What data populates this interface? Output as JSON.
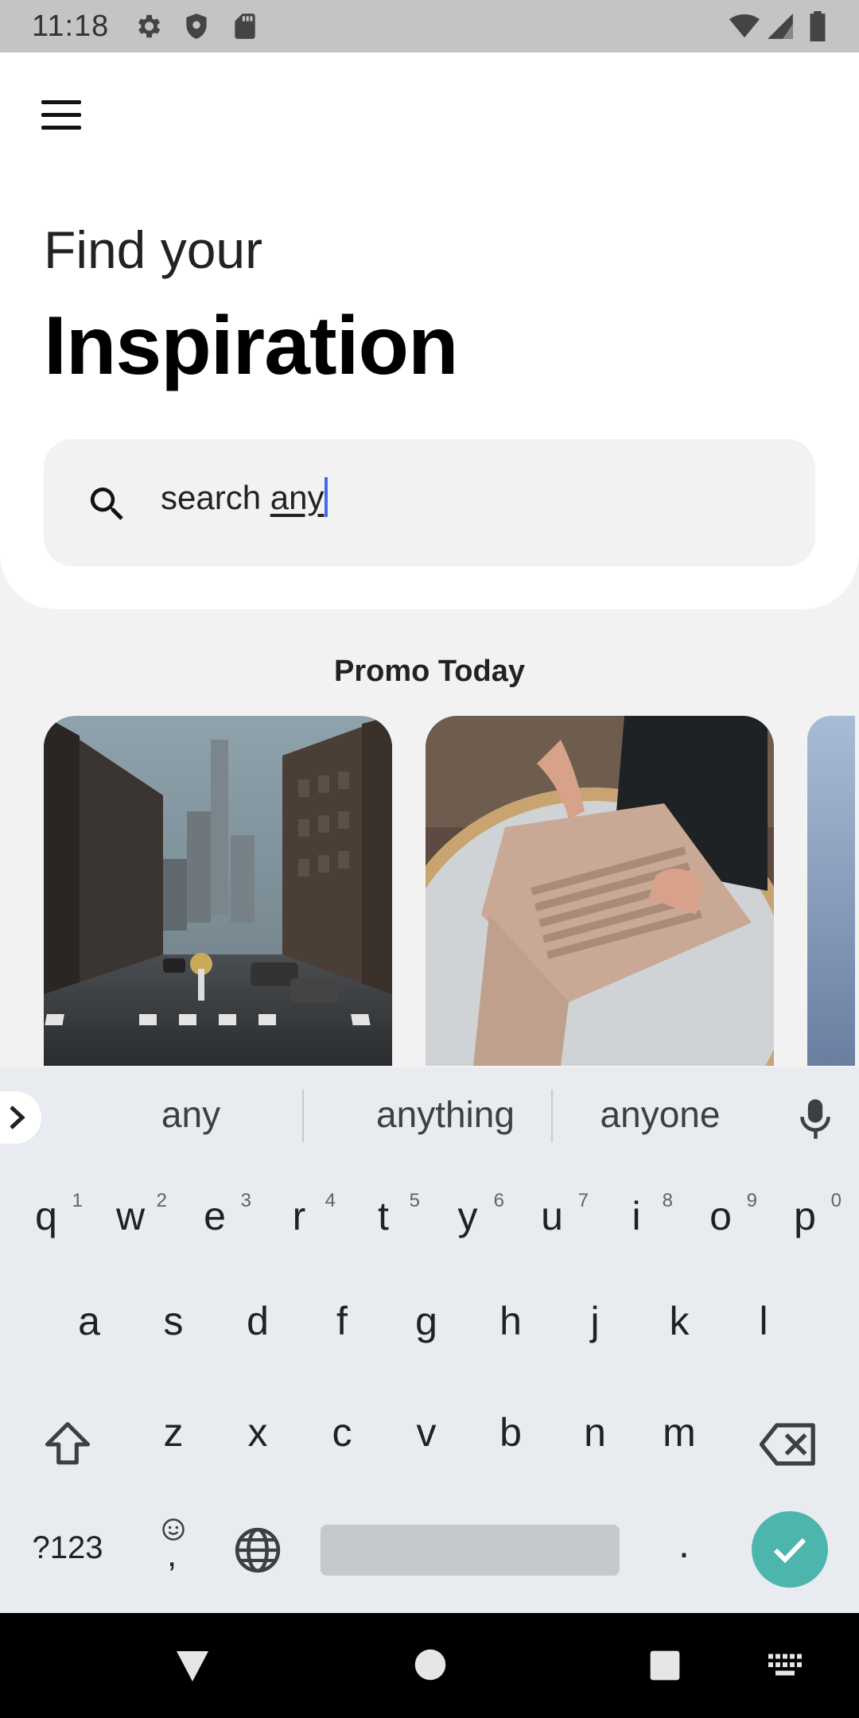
{
  "status_bar": {
    "time": "11:18",
    "icons": [
      "gear-icon",
      "shield-icon",
      "sd-card-icon",
      "wifi-icon",
      "signal-icon",
      "battery-icon"
    ]
  },
  "header": {
    "menu_icon": "hamburger-menu-icon",
    "line1": "Find your",
    "line2": "Inspiration"
  },
  "search": {
    "icon": "search-icon",
    "prefix": "search ",
    "typed": "any"
  },
  "promo": {
    "title": "Promo Today",
    "cards": [
      {
        "name": "city-street-photo"
      },
      {
        "name": "laptop-photo"
      },
      {
        "name": "partial-card"
      }
    ]
  },
  "keyboard": {
    "suggestions": [
      "any",
      "anything",
      "anyone"
    ],
    "row1": [
      {
        "k": "q",
        "n": "1"
      },
      {
        "k": "w",
        "n": "2"
      },
      {
        "k": "e",
        "n": "3"
      },
      {
        "k": "r",
        "n": "4"
      },
      {
        "k": "t",
        "n": "5"
      },
      {
        "k": "y",
        "n": "6"
      },
      {
        "k": "u",
        "n": "7"
      },
      {
        "k": "i",
        "n": "8"
      },
      {
        "k": "o",
        "n": "9"
      },
      {
        "k": "p",
        "n": "0"
      }
    ],
    "row2": [
      "a",
      "s",
      "d",
      "f",
      "g",
      "h",
      "j",
      "k",
      "l"
    ],
    "row3": [
      "z",
      "x",
      "c",
      "v",
      "b",
      "n",
      "m"
    ],
    "symbols_label": "?123",
    "emoji_comma": ",",
    "period": ".",
    "enter_color": "#4db6ac"
  },
  "colors": {
    "accent_caret": "#3b6ee8",
    "background": "#f2f2f2",
    "card": "#ffffff"
  }
}
